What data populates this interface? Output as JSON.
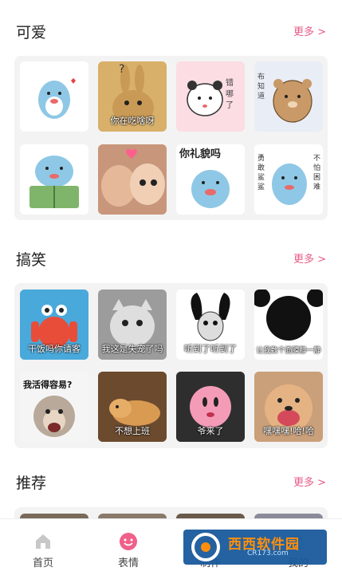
{
  "sections": [
    {
      "title": "可爱",
      "more": "更多 >",
      "tiles": [
        {
          "icon": "dolphin-cheer-sticker",
          "caption": ""
        },
        {
          "icon": "rabbit-photo",
          "caption": "你在吃啥呀"
        },
        {
          "icon": "panda-bear-sticker",
          "caption": ""
        },
        {
          "icon": "brown-bear-sticker",
          "caption": ""
        },
        {
          "icon": "dolphin-book-sticker",
          "caption": ""
        },
        {
          "icon": "cats-photo",
          "caption": ""
        },
        {
          "icon": "dolphin-polite-sticker",
          "caption": ""
        },
        {
          "icon": "dolphin-brave-sticker",
          "caption": ""
        }
      ]
    },
    {
      "title": "搞笑",
      "more": "更多 >",
      "tiles": [
        {
          "icon": "crab-cartoon",
          "caption": "干饭吗你请客"
        },
        {
          "icon": "gray-cat-photo",
          "caption": "我这是失宠了吗"
        },
        {
          "icon": "panda-meme",
          "caption": "听到了听到了"
        },
        {
          "icon": "panda-bw-meme",
          "caption": "让我数个面膜静一静"
        },
        {
          "icon": "monkey-photo",
          "caption": "我活得容易?"
        },
        {
          "icon": "dog-lying-photo",
          "caption": "不想上班"
        },
        {
          "icon": "pink-round-character",
          "caption": "爷来了"
        },
        {
          "icon": "laughing-dog-photo",
          "caption": "嘿嘿嘿!哈!哈"
        }
      ]
    },
    {
      "title": "推荐",
      "more": "更多 >",
      "tiles": []
    }
  ],
  "tabbar": {
    "items": [
      {
        "label": "首页",
        "icon": "home-icon"
      },
      {
        "label": "表情",
        "icon": "smile-icon"
      },
      {
        "label": "制作",
        "icon": "make-icon"
      },
      {
        "label": "我的",
        "icon": "user-icon"
      }
    ]
  },
  "watermark": {
    "text": "西西软件园",
    "sub": "CR173.com"
  },
  "colors": {
    "accent": "#e85b86",
    "card_bg": "#f3f3f3"
  }
}
